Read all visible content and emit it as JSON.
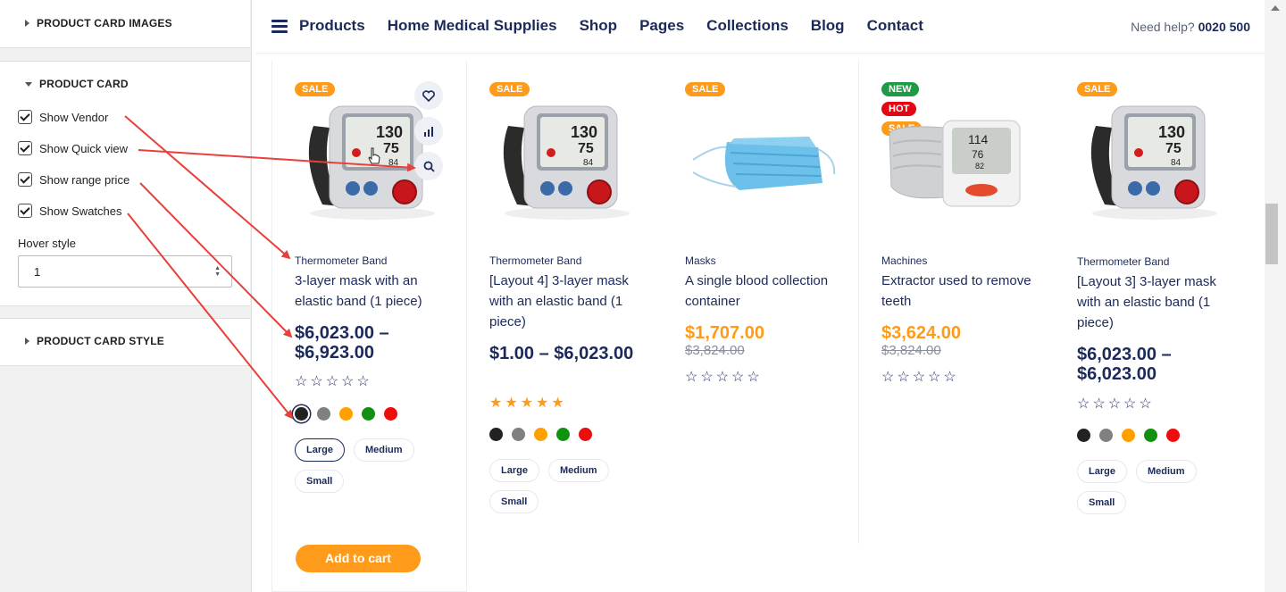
{
  "sidebar": {
    "sections": {
      "images": "PRODUCT CARD IMAGES",
      "card": "PRODUCT CARD",
      "style": "PRODUCT CARD STYLE"
    },
    "options": [
      "Show Vendor",
      "Show Quick view",
      "Show range price",
      "Show Swatches"
    ],
    "hover_style_label": "Hover style",
    "hover_style_value": "1"
  },
  "nav": {
    "menu_icon": "hamburger-icon",
    "items": [
      "Products",
      "Home Medical Supplies",
      "Shop",
      "Pages",
      "Collections",
      "Blog",
      "Contact"
    ],
    "help_label": "Need help?",
    "help_phone": "0020 500"
  },
  "card_icons": [
    "heart-icon",
    "compare-chart-icon",
    "search-icon"
  ],
  "products": [
    {
      "badges": [
        "SALE"
      ],
      "vendor": "Thermometer Band",
      "name": "3-layer mask with an elastic band (1 piece)",
      "price": "$6,023.00 – $6,923.00",
      "old_price": "",
      "stars": "☆☆☆☆☆",
      "swatches": [
        "#222222",
        "#808080",
        "#ff9f00",
        "#119111",
        "#ee0d0d"
      ],
      "sizes": [
        "Large",
        "Medium",
        "Small"
      ],
      "cart": "Add to cart"
    },
    {
      "badges": [
        "SALE"
      ],
      "vendor": "Thermometer Band",
      "name": "[Layout 4] 3-layer mask with an elastic band (1 piece)",
      "price": "$1.00 – $6,023.00",
      "old_price": "",
      "stars": "★★★★★",
      "swatches": [
        "#222222",
        "#808080",
        "#ff9f00",
        "#119111",
        "#ee0d0d"
      ],
      "sizes": [
        "Large",
        "Medium",
        "Small"
      ]
    },
    {
      "badges": [
        "SALE"
      ],
      "vendor": "Masks",
      "name": "A single blood collection container",
      "price": "$1,707.00",
      "old_price": "$3,824.00",
      "stars": "☆☆☆☆☆"
    },
    {
      "badges": [
        "NEW",
        "HOT",
        "SALE"
      ],
      "vendor": "Machines",
      "name": "Extractor used to remove teeth",
      "price": "$3,624.00",
      "old_price": "$3,824.00",
      "stars": "☆☆☆☆☆"
    },
    {
      "badges": [
        "SALE"
      ],
      "vendor": "Thermometer Band",
      "name": "[Layout 3] 3-layer mask with an elastic band (1 piece)",
      "price": "$6,023.00 – $6,023.00",
      "old_price": "",
      "stars": "☆☆☆☆☆",
      "swatches": [
        "#222222",
        "#808080",
        "#ff9f00",
        "#119111",
        "#ee0d0d"
      ],
      "sizes": [
        "Large",
        "Medium",
        "Small"
      ]
    }
  ],
  "colors": {
    "brand_navy": "#1b2a5a",
    "accent_orange": "#ff9b1a",
    "new_badge": "#1f9b47",
    "hot_badge": "#e40613",
    "annotation_arrow": "#e8403a"
  }
}
